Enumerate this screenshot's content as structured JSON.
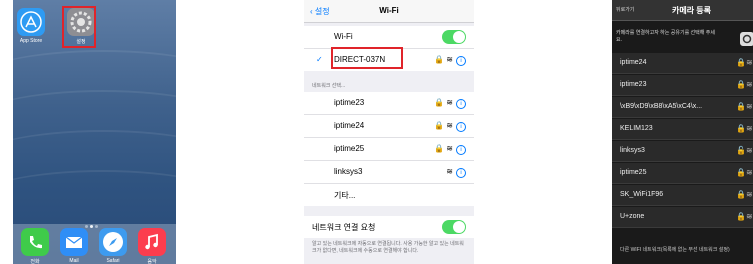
{
  "home": {
    "apps": [
      {
        "label": "App Store",
        "icon": "appstore-icon",
        "color": "#2e9bf3"
      },
      {
        "label": "설정",
        "icon": "settings-gear-icon",
        "color": "#8e8e93"
      }
    ],
    "dock": [
      {
        "label": "전화",
        "icon": "phone-icon",
        "color": "#3fcb4a"
      },
      {
        "label": "Mail",
        "icon": "mail-icon",
        "color": "#2f8ef6"
      },
      {
        "label": "Safari",
        "icon": "safari-icon",
        "color": "#3d9bef"
      },
      {
        "label": "음악",
        "icon": "music-icon",
        "color": "#fc3d4e"
      }
    ]
  },
  "wifi": {
    "back_label": "설정",
    "title": "Wi-Fi",
    "wifi_label": "Wi-Fi",
    "connected_network": "DIRECT-037N",
    "section_label": "네트워크 선택...",
    "networks": [
      "iptime23",
      "iptime24",
      "iptime25",
      "linksys3"
    ],
    "other_label": "기타...",
    "ask_join_label": "네트워크 연결 요청",
    "ask_join_desc": "알고 있는 네트워크에 자동으로 연결됩니다. 사용 가능한 알고 있는 네트워크가 없다면, 네트워크에 수동으로 연결해야 합니다."
  },
  "camera": {
    "back_label": "뒤로가기",
    "title": "카메라 등록",
    "instruction": "카메라를 연결하고자 하는 공유기를 선택해 주세요.",
    "networks": [
      "iptime24",
      "iptime23",
      "\\xB9\\xD9\\xB8\\xA5\\xC4\\x...",
      "KELIM123",
      "linksys3",
      "iptime25",
      "SK_WiFi1F96",
      "U+zone"
    ],
    "footer_note": "다른 WIFI 네트워크(목록에 없는 무선 네트워크 설정)"
  },
  "colors": {
    "accent": "#007aff",
    "toggle_on": "#4cd964",
    "highlight": "#e0242a"
  }
}
